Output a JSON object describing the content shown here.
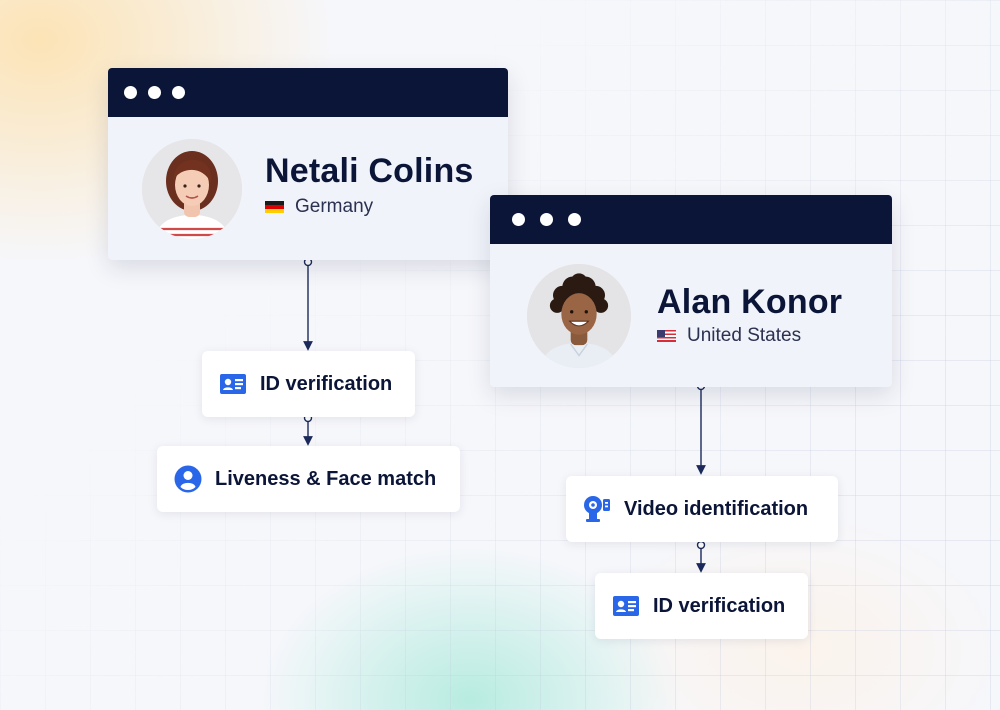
{
  "profiles": [
    {
      "name": "Netali Colins",
      "country": "Germany",
      "flag_icon": "flag-germany-icon",
      "steps": [
        "ID verification",
        "Liveness & Face match"
      ],
      "step_icons": [
        "id-card-icon",
        "person-circle-icon"
      ]
    },
    {
      "name": "Alan Konor",
      "country": "United States",
      "flag_icon": "flag-usa-icon",
      "steps": [
        "Video identification",
        "ID verification"
      ],
      "step_icons": [
        "video-camera-icon",
        "id-card-icon"
      ]
    }
  ],
  "colors": {
    "navy": "#0b1538",
    "accent_blue": "#2a66e8",
    "connector": "#1b2a5a"
  }
}
